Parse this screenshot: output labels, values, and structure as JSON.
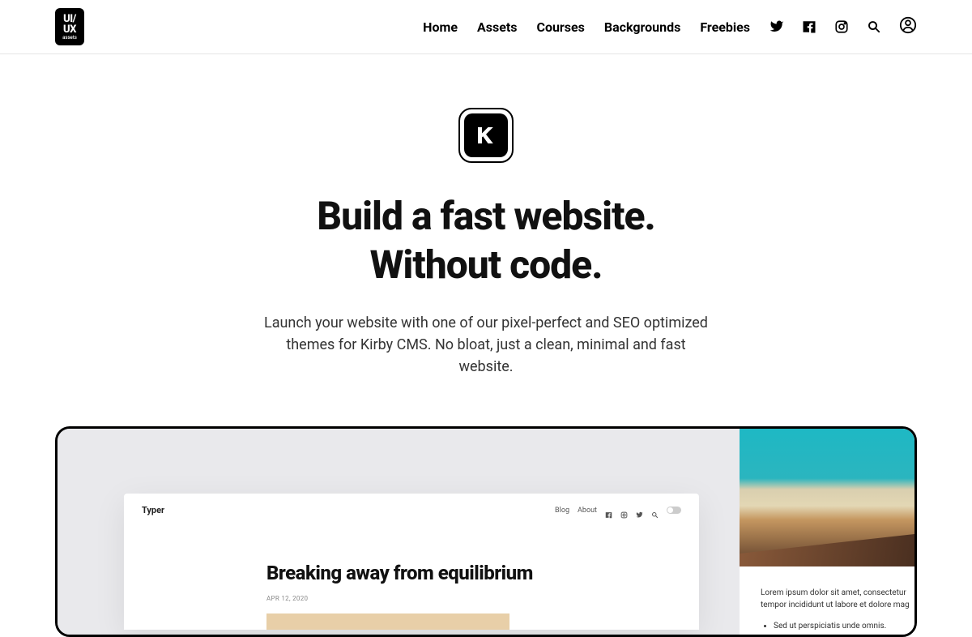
{
  "header": {
    "logo_top": "UI/",
    "logo_mid": "UX",
    "logo_bottom": "assets",
    "nav": [
      {
        "label": "Home"
      },
      {
        "label": "Assets"
      },
      {
        "label": "Courses"
      },
      {
        "label": "Backgrounds"
      },
      {
        "label": "Freebies"
      }
    ]
  },
  "hero": {
    "badge_letter": "K",
    "title_line1": "Build a fast website.",
    "title_line2": "Without code.",
    "subtitle": "Launch your website with one of our pixel-perfect and SEO optimized themes for Kirby CMS. No bloat, just a clean, minimal and fast website."
  },
  "showcase": {
    "mock": {
      "brand": "Typer",
      "nav_blog": "Blog",
      "nav_about": "About",
      "heading": "Breaking away from equilibrium",
      "date": "APR 12, 2020"
    },
    "side": {
      "paragraph": "Lorem ipsum dolor sit amet, consectetur tempor incididunt ut labore et dolore mag",
      "bullet1": "Sed ut perspiciatis unde omnis."
    }
  }
}
